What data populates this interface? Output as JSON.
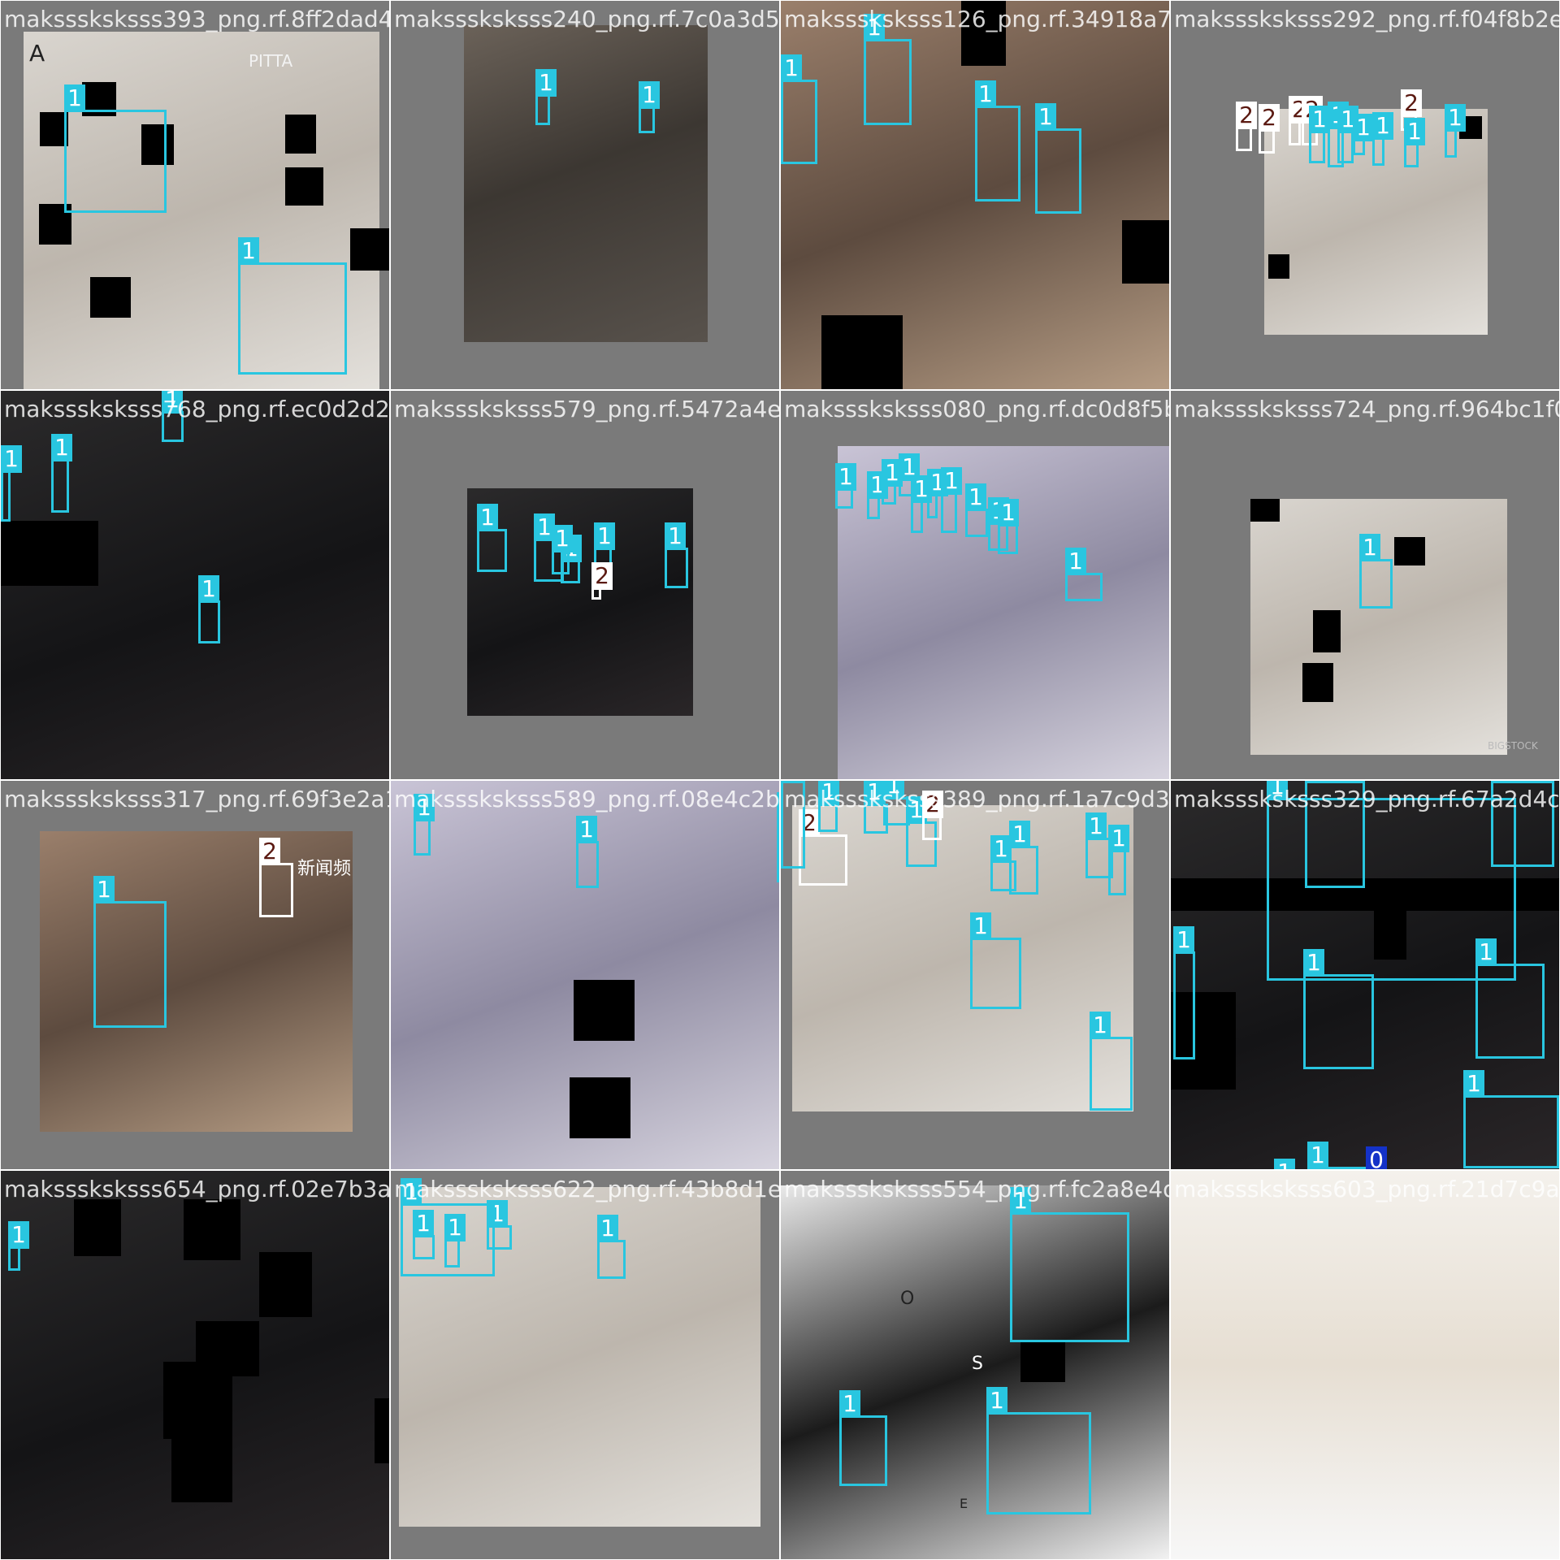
{
  "mosaic": {
    "tiles": [
      {
        "filename": "maksssksksss393_png.rf.8ff2dad4d3dbd8a3db40",
        "photo_style": "light",
        "scene_text": [
          "A",
          "PITTA"
        ]
      },
      {
        "filename": "maksssksksss240_png.rf.7c0a3d5e5e2b0ce4",
        "photo_style": "",
        "scene_text": []
      },
      {
        "filename": "maksssksksss126_png.rf.34918a77e7c3ad80",
        "photo_style": "warm",
        "scene_text": []
      },
      {
        "filename": "maksssksksss292_png.rf.f04f8b2e4d6c7a31",
        "photo_style": "light",
        "scene_text": []
      },
      {
        "filename": "maksssksksss768_png.rf.ec0d2d2f1dd7c3a9",
        "photo_style": "dark",
        "scene_text": []
      },
      {
        "filename": "maksssksksss579_png.rf.5472a4e7d1a9c2e0",
        "photo_style": "dark",
        "scene_text": []
      },
      {
        "filename": "maksssksksss080_png.rf.dc0d8f5b1a3e2c74",
        "photo_style": "cool",
        "scene_text": []
      },
      {
        "filename": "maksssksksss724_png.rf.964bc1f0a8e3d5a2",
        "photo_style": "light",
        "scene_text": [
          "BIGSTOCK"
        ]
      },
      {
        "filename": "maksssksksss317_png.rf.69f3e2a1c7d8b4e5",
        "photo_style": "warm",
        "scene_text": [
          "新闻频"
        ]
      },
      {
        "filename": "maksssksksss589_png.rf.08e4c2b7a1d3f6e9",
        "photo_style": "cool",
        "scene_text": []
      },
      {
        "filename": "maksssksksss389_png.rf.1a7c9d3e5b2f4a80",
        "photo_style": "light",
        "scene_text": []
      },
      {
        "filename": "maksssksksss329_png.rf.67a2d4c8e1f3b5d9",
        "photo_style": "dark",
        "scene_text": []
      },
      {
        "filename": "maksssksksss654_png.rf.02e7b3a9c1d5f4e8",
        "photo_style": "dark",
        "scene_text": []
      },
      {
        "filename": "maksssksksss622_png.rf.43b8d1e5a2c7f903",
        "photo_style": "light",
        "scene_text": []
      },
      {
        "filename": "maksssksksss554_png.rf.fc2a8e4d1b7c3f96",
        "photo_style": "mono",
        "scene_text": [
          "O",
          "S",
          "E"
        ]
      },
      {
        "filename": "maksssksksss603_png.rf.21d7c9a4e3b8f5c6",
        "photo_style": "snow",
        "scene_text": []
      }
    ]
  },
  "classes": {
    "0": {
      "label": "0",
      "color": "#1432c8"
    },
    "1": {
      "label": "1",
      "color": "#29c6e0"
    },
    "2": {
      "label": "2",
      "color": "#ffffff"
    }
  },
  "detections": [
    {
      "tile": 0,
      "cls": "1",
      "label": "1"
    },
    {
      "tile": 0,
      "cls": "1",
      "label": "1"
    },
    {
      "tile": 1,
      "cls": "1",
      "label": "1"
    },
    {
      "tile": 1,
      "cls": "1",
      "label": "1"
    },
    {
      "tile": 2,
      "cls": "1",
      "label": "1"
    },
    {
      "tile": 2,
      "cls": "1",
      "label": "1"
    },
    {
      "tile": 2,
      "cls": "1",
      "label": "1"
    },
    {
      "tile": 2,
      "cls": "1",
      "label": "1"
    },
    {
      "tile": 3,
      "cls": "2",
      "label": "2"
    },
    {
      "tile": 3,
      "cls": "2",
      "label": "2"
    },
    {
      "tile": 3,
      "cls": "2",
      "label": "2"
    },
    {
      "tile": 3,
      "cls": "2",
      "label": "2"
    },
    {
      "tile": 3,
      "cls": "1",
      "label": "1"
    },
    {
      "tile": 3,
      "cls": "1",
      "label": "1"
    },
    {
      "tile": 3,
      "cls": "1",
      "label": "1"
    },
    {
      "tile": 3,
      "cls": "1",
      "label": "1"
    },
    {
      "tile": 3,
      "cls": "1",
      "label": "1"
    },
    {
      "tile": 3,
      "cls": "2",
      "label": "2"
    },
    {
      "tile": 3,
      "cls": "1",
      "label": "1"
    },
    {
      "tile": 3,
      "cls": "1",
      "label": "1"
    },
    {
      "tile": 4,
      "cls": "1",
      "label": "1"
    },
    {
      "tile": 4,
      "cls": "1",
      "label": "1"
    },
    {
      "tile": 4,
      "cls": "1",
      "label": "1"
    },
    {
      "tile": 4,
      "cls": "1",
      "label": "1"
    },
    {
      "tile": 5,
      "cls": "1",
      "label": "1"
    },
    {
      "tile": 5,
      "cls": "1",
      "label": "1"
    },
    {
      "tile": 5,
      "cls": "1",
      "label": "1"
    },
    {
      "tile": 5,
      "cls": "1",
      "label": "1"
    },
    {
      "tile": 5,
      "cls": "1",
      "label": "1"
    },
    {
      "tile": 5,
      "cls": "2",
      "label": "2"
    },
    {
      "tile": 5,
      "cls": "1",
      "label": "1"
    },
    {
      "tile": 6,
      "cls": "1",
      "label": "1"
    },
    {
      "tile": 6,
      "cls": "1",
      "label": "1"
    },
    {
      "tile": 6,
      "cls": "1",
      "label": "1"
    },
    {
      "tile": 6,
      "cls": "1",
      "label": "1"
    },
    {
      "tile": 6,
      "cls": "1",
      "label": "1"
    },
    {
      "tile": 6,
      "cls": "1",
      "label": "1"
    },
    {
      "tile": 6,
      "cls": "1",
      "label": "1"
    },
    {
      "tile": 6,
      "cls": "1",
      "label": "1"
    },
    {
      "tile": 6,
      "cls": "1",
      "label": "1"
    },
    {
      "tile": 6,
      "cls": "1",
      "label": "1"
    },
    {
      "tile": 6,
      "cls": "1",
      "label": "1"
    },
    {
      "tile": 7,
      "cls": "1",
      "label": "1"
    },
    {
      "tile": 8,
      "cls": "1",
      "label": "1"
    },
    {
      "tile": 8,
      "cls": "2",
      "label": "2"
    },
    {
      "tile": 9,
      "cls": "1",
      "label": "1"
    },
    {
      "tile": 9,
      "cls": "1",
      "label": "1"
    },
    {
      "tile": 9,
      "cls": "1",
      "label": "1"
    },
    {
      "tile": 10,
      "cls": "2",
      "label": "2"
    },
    {
      "tile": 10,
      "cls": "1",
      "label": "1"
    },
    {
      "tile": 10,
      "cls": "1",
      "label": "1"
    },
    {
      "tile": 10,
      "cls": "1",
      "label": "1"
    },
    {
      "tile": 10,
      "cls": "1",
      "label": "1"
    },
    {
      "tile": 10,
      "cls": "2",
      "label": "2"
    },
    {
      "tile": 10,
      "cls": "1",
      "label": "1"
    },
    {
      "tile": 10,
      "cls": "1",
      "label": "1"
    },
    {
      "tile": 10,
      "cls": "1",
      "label": "1"
    },
    {
      "tile": 10,
      "cls": "1",
      "label": "1"
    },
    {
      "tile": 10,
      "cls": "1",
      "label": "1"
    },
    {
      "tile": 10,
      "cls": "1",
      "label": "1"
    },
    {
      "tile": 10,
      "cls": "1",
      "label": "1"
    },
    {
      "tile": 11,
      "cls": "1",
      "label": "1"
    },
    {
      "tile": 11,
      "cls": "1",
      "label": "1"
    },
    {
      "tile": 11,
      "cls": "1",
      "label": "1"
    },
    {
      "tile": 11,
      "cls": "1",
      "label": "1"
    },
    {
      "tile": 11,
      "cls": "1",
      "label": "1"
    },
    {
      "tile": 11,
      "cls": "1",
      "label": "1"
    },
    {
      "tile": 11,
      "cls": "1",
      "label": "1"
    },
    {
      "tile": 11,
      "cls": "1",
      "label": "1"
    },
    {
      "tile": 11,
      "cls": "0",
      "label": "0"
    },
    {
      "tile": 11,
      "cls": "1",
      "label": "1"
    },
    {
      "tile": 12,
      "cls": "1",
      "label": "1"
    },
    {
      "tile": 13,
      "cls": "1",
      "label": "1"
    },
    {
      "tile": 13,
      "cls": "1",
      "label": "1"
    },
    {
      "tile": 13,
      "cls": "1",
      "label": "1"
    },
    {
      "tile": 13,
      "cls": "1",
      "label": "1"
    },
    {
      "tile": 13,
      "cls": "1",
      "label": "1"
    },
    {
      "tile": 14,
      "cls": "1",
      "label": "1"
    },
    {
      "tile": 14,
      "cls": "1",
      "label": "1"
    },
    {
      "tile": 14,
      "cls": "1",
      "label": "1"
    },
    {
      "tile": 14,
      "cls": "1",
      "label": "1"
    }
  ]
}
